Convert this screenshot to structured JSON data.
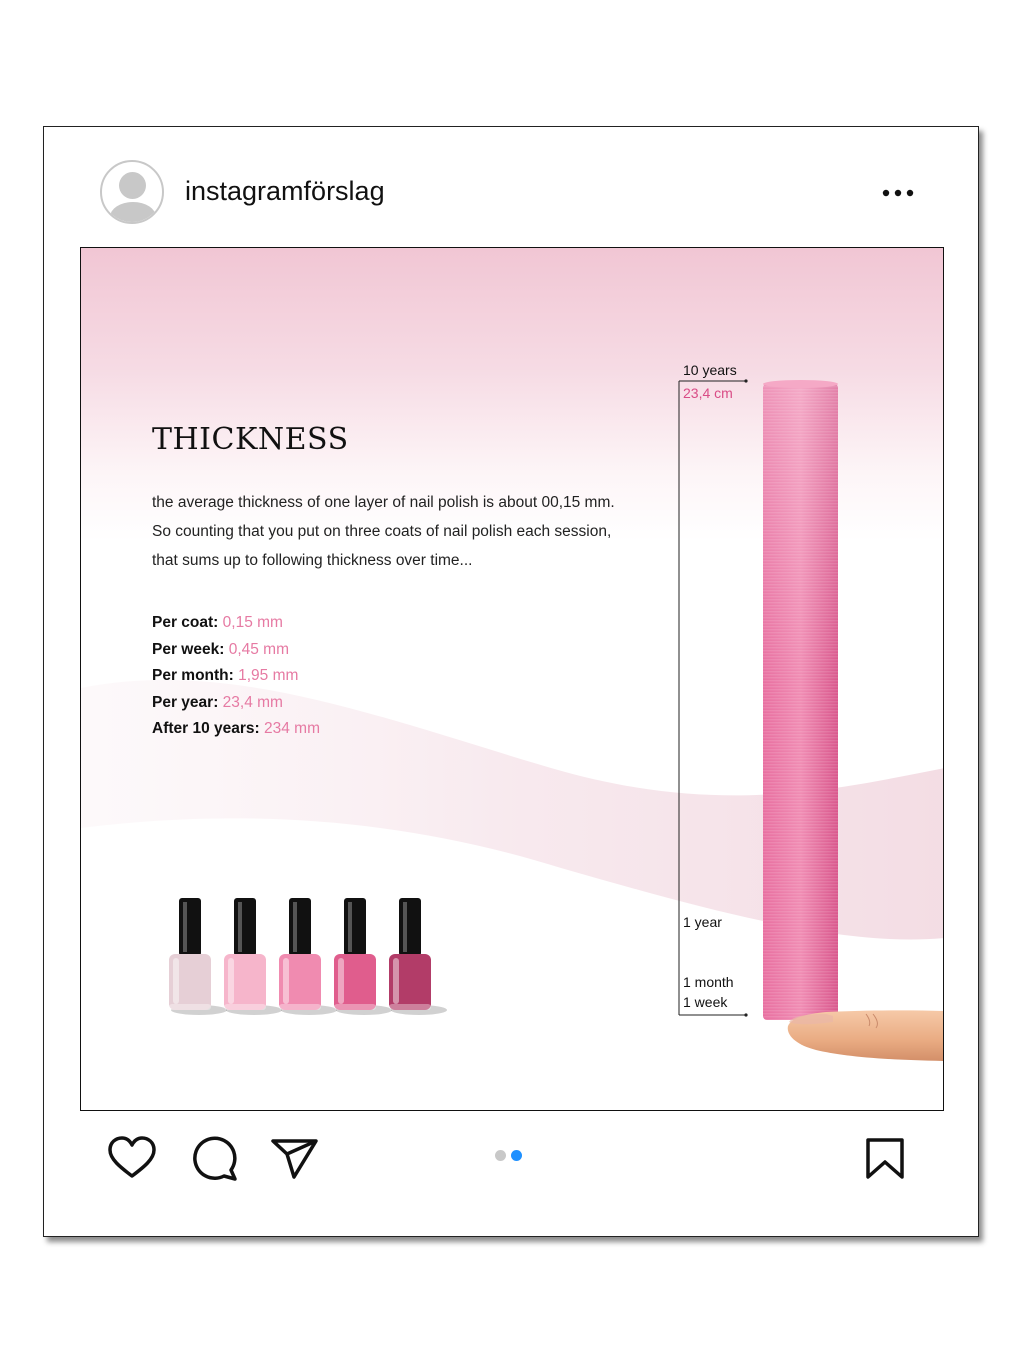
{
  "header": {
    "username": "instagramförslag",
    "avatar_icon": "avatar-placeholder-icon",
    "more_icon": "more-options-icon"
  },
  "post": {
    "title": "THICKNESS",
    "description_lines": [
      "the average thickness of one layer of nail polish is about 00,15 mm.",
      "So counting that you put on three coats of nail polish each session,",
      "that sums up to following thickness over time..."
    ],
    "stats": [
      {
        "label": "Per coat:",
        "value": "0,15 mm"
      },
      {
        "label": "Per week:",
        "value": "0,45 mm"
      },
      {
        "label": "Per month:",
        "value": "1,95 mm"
      },
      {
        "label": "Per year:",
        "value": "23,4 mm"
      },
      {
        "label": "After 10 years:",
        "value": "234 mm"
      }
    ],
    "scale": {
      "ten_years": "10 years",
      "total": "23,4 cm",
      "one_year": "1 year",
      "one_month": "1 month",
      "one_week": "1 week"
    },
    "bottle_colors": [
      "#e6cfd6",
      "#f6b5cb",
      "#f08bb0",
      "#e05d8d",
      "#b23c68"
    ],
    "accent_color": "#e67aa3"
  },
  "actions": {
    "like_icon": "heart-icon",
    "comment_icon": "comment-icon",
    "share_icon": "send-icon",
    "save_icon": "bookmark-icon",
    "carousel": {
      "count": 2,
      "active": 2,
      "active_color": "#1e90ff",
      "inactive_color": "#c8c8c8"
    }
  }
}
